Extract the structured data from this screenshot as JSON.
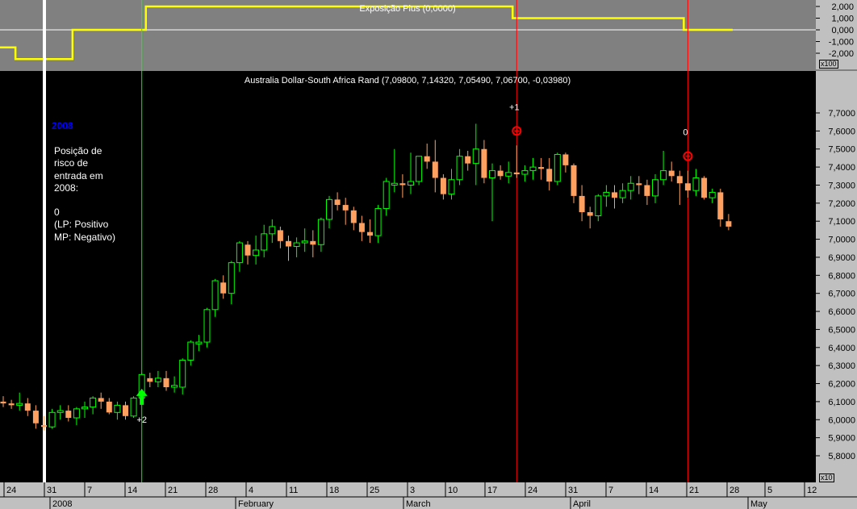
{
  "indicator": {
    "title": "Exposição Plus (0,0000)",
    "y_ticks": [
      "2,000",
      "1,000",
      "0,000",
      "-1,000",
      "-2,000"
    ],
    "multiplier": "x100"
  },
  "price": {
    "title": "Australia Dollar-South Africa Rand (7,09800, 7,14320, 7,05490, 7,06700, -0,03980)",
    "y_ticks": [
      "7,7000",
      "7,6000",
      "7,5000",
      "7,4000",
      "7,3000",
      "7,2000",
      "7,1000",
      "7,0000",
      "6,9000",
      "6,8000",
      "6,7000",
      "6,6000",
      "6,5000",
      "6,4000",
      "6,3000",
      "6,2000",
      "6,1000",
      "6,0000",
      "5,9000",
      "5,8000"
    ],
    "multiplier": "x10"
  },
  "info": {
    "year": "2008",
    "lines": [
      "Posição de",
      "risco de",
      "entrada em",
      "2008:",
      "",
      "0",
      "(LP: Positivo",
      "MP: Negativo)"
    ]
  },
  "signals": [
    {
      "label": "+2",
      "type": "up-arrow",
      "index": 17
    },
    {
      "label": "+1",
      "type": "circle",
      "index": 63
    },
    {
      "label": "0",
      "type": "circle",
      "index": 84
    }
  ],
  "x_axis": {
    "day_ticks": [
      "24",
      "31",
      "7",
      "14",
      "21",
      "28",
      "4",
      "11",
      "18",
      "25",
      "3",
      "10",
      "17",
      "24",
      "31",
      "7",
      "14",
      "21",
      "28",
      "5",
      "12"
    ],
    "months": [
      "2008",
      "February",
      "March",
      "April",
      "May"
    ]
  },
  "colors": {
    "up": "#00ff00",
    "down": "#ffa060",
    "indicator_line": "#ffff00",
    "indicator_bg": "#808080",
    "signal_line": "#ff0000",
    "entry_line": "#00ff00",
    "year_text": "#0000ff"
  },
  "chart_data": {
    "type": "candlestick",
    "title": "Australia Dollar-South Africa Rand (7,09800, 7,14320, 7,05490, 7,06700, -0,03980)",
    "ylim": [
      5.8,
      7.75
    ],
    "indicator_title": "Exposição Plus (0,0000)",
    "indicator_ylim": [
      -3,
      2.6
    ],
    "indicator": [
      -1.5,
      -1.5,
      -2.5,
      -2.5,
      -2.5,
      -2.5,
      -2.5,
      -2.5,
      -2.5,
      0,
      0,
      0,
      0,
      0,
      0,
      0,
      0,
      0,
      2,
      2,
      2,
      2,
      2,
      2,
      2,
      2,
      2,
      2,
      2,
      2,
      2,
      2,
      2,
      2,
      2,
      2,
      2,
      2,
      2,
      2,
      2,
      2,
      2,
      2,
      2,
      2,
      2,
      2,
      2,
      2,
      2,
      2,
      2,
      2,
      2,
      2,
      2,
      2,
      2,
      2,
      2,
      2,
      2,
      1,
      1,
      1,
      1,
      1,
      1,
      1,
      1,
      1,
      1,
      1,
      1,
      1,
      1,
      1,
      1,
      1,
      1,
      1,
      1,
      1,
      0,
      0,
      0,
      0,
      0,
      0
    ],
    "ohlc": [
      [
        6.1,
        6.13,
        6.07,
        6.09
      ],
      [
        6.09,
        6.11,
        6.06,
        6.08
      ],
      [
        6.08,
        6.15,
        6.05,
        6.09
      ],
      [
        6.09,
        6.12,
        6.02,
        6.05
      ],
      [
        6.05,
        6.08,
        5.95,
        5.98
      ],
      [
        5.97,
        6.02,
        5.94,
        5.96
      ],
      [
        5.96,
        6.06,
        5.95,
        6.04
      ],
      [
        6.04,
        6.08,
        6.0,
        6.05
      ],
      [
        6.05,
        6.08,
        5.99,
        6.01
      ],
      [
        6.01,
        6.07,
        5.97,
        6.06
      ],
      [
        6.06,
        6.1,
        6.01,
        6.07
      ],
      [
        6.07,
        6.13,
        6.03,
        6.12
      ],
      [
        6.12,
        6.15,
        6.06,
        6.1
      ],
      [
        6.1,
        6.12,
        6.03,
        6.04
      ],
      [
        6.04,
        6.1,
        6.0,
        6.08
      ],
      [
        6.08,
        6.1,
        6.0,
        6.02
      ],
      [
        6.02,
        6.13,
        6.01,
        6.12
      ],
      [
        6.12,
        6.26,
        6.1,
        6.25
      ],
      [
        6.23,
        6.26,
        6.18,
        6.21
      ],
      [
        6.21,
        6.27,
        6.18,
        6.23
      ],
      [
        6.23,
        6.27,
        6.16,
        6.18
      ],
      [
        6.18,
        6.24,
        6.15,
        6.19
      ],
      [
        6.18,
        6.34,
        6.14,
        6.33
      ],
      [
        6.33,
        6.44,
        6.3,
        6.43
      ],
      [
        6.42,
        6.47,
        6.38,
        6.43
      ],
      [
        6.43,
        6.62,
        6.4,
        6.61
      ],
      [
        6.61,
        6.78,
        6.57,
        6.77
      ],
      [
        6.76,
        6.8,
        6.67,
        6.7
      ],
      [
        6.7,
        6.88,
        6.64,
        6.87
      ],
      [
        6.87,
        6.99,
        6.82,
        6.98
      ],
      [
        6.97,
        6.99,
        6.86,
        6.91
      ],
      [
        6.91,
        7.02,
        6.86,
        6.94
      ],
      [
        6.94,
        7.08,
        6.9,
        7.03
      ],
      [
        7.03,
        7.11,
        6.98,
        7.07
      ],
      [
        7.05,
        7.07,
        6.95,
        6.99
      ],
      [
        6.99,
        7.02,
        6.88,
        6.96
      ],
      [
        6.96,
        7.01,
        6.9,
        6.98
      ],
      [
        6.98,
        7.06,
        6.93,
        6.99
      ],
      [
        6.99,
        7.05,
        6.9,
        6.97
      ],
      [
        6.97,
        7.12,
        6.93,
        7.11
      ],
      [
        7.11,
        7.24,
        7.06,
        7.22
      ],
      [
        7.22,
        7.26,
        7.16,
        7.19
      ],
      [
        7.19,
        7.23,
        7.08,
        7.16
      ],
      [
        7.16,
        7.18,
        7.05,
        7.09
      ],
      [
        7.09,
        7.13,
        6.99,
        7.04
      ],
      [
        7.04,
        7.11,
        6.98,
        7.02
      ],
      [
        7.02,
        7.19,
        6.98,
        7.17
      ],
      [
        7.17,
        7.34,
        7.13,
        7.32
      ],
      [
        7.3,
        7.5,
        7.26,
        7.31
      ],
      [
        7.31,
        7.36,
        7.23,
        7.3
      ],
      [
        7.3,
        7.48,
        7.25,
        7.32
      ],
      [
        7.32,
        7.45,
        7.3,
        7.46
      ],
      [
        7.46,
        7.53,
        7.39,
        7.43
      ],
      [
        7.43,
        7.55,
        7.26,
        7.34
      ],
      [
        7.34,
        7.36,
        7.22,
        7.25
      ],
      [
        7.25,
        7.39,
        7.22,
        7.33
      ],
      [
        7.33,
        7.5,
        7.3,
        7.46
      ],
      [
        7.46,
        7.49,
        7.38,
        7.42
      ],
      [
        7.42,
        7.64,
        7.3,
        7.5
      ],
      [
        7.5,
        7.55,
        7.31,
        7.34
      ],
      [
        7.34,
        7.42,
        7.1,
        7.38
      ],
      [
        7.38,
        7.41,
        7.33,
        7.35
      ],
      [
        7.35,
        7.43,
        7.31,
        7.37
      ],
      [
        7.37,
        7.52,
        7.34,
        7.36
      ],
      [
        7.36,
        7.41,
        7.32,
        7.38
      ],
      [
        7.38,
        7.45,
        7.33,
        7.4
      ],
      [
        7.4,
        7.45,
        7.33,
        7.39
      ],
      [
        7.39,
        7.45,
        7.27,
        7.32
      ],
      [
        7.32,
        7.48,
        7.3,
        7.47
      ],
      [
        7.47,
        7.48,
        7.37,
        7.41
      ],
      [
        7.41,
        7.42,
        7.2,
        7.24
      ],
      [
        7.24,
        7.3,
        7.1,
        7.15
      ],
      [
        7.15,
        7.18,
        7.06,
        7.13
      ],
      [
        7.13,
        7.25,
        7.1,
        7.24
      ],
      [
        7.24,
        7.3,
        7.18,
        7.26
      ],
      [
        7.26,
        7.3,
        7.17,
        7.23
      ],
      [
        7.23,
        7.31,
        7.2,
        7.27
      ],
      [
        7.27,
        7.35,
        7.22,
        7.31
      ],
      [
        7.31,
        7.35,
        7.25,
        7.3
      ],
      [
        7.3,
        7.33,
        7.19,
        7.24
      ],
      [
        7.24,
        7.36,
        7.2,
        7.33
      ],
      [
        7.33,
        7.49,
        7.3,
        7.38
      ],
      [
        7.38,
        7.43,
        7.32,
        7.35
      ],
      [
        7.35,
        7.38,
        7.19,
        7.31
      ],
      [
        7.31,
        7.38,
        7.23,
        7.27
      ],
      [
        7.27,
        7.39,
        7.24,
        7.34
      ],
      [
        7.34,
        7.35,
        7.22,
        7.23
      ],
      [
        7.23,
        7.28,
        7.2,
        7.26
      ],
      [
        7.26,
        7.28,
        7.07,
        7.11
      ],
      [
        7.1,
        7.14,
        7.05,
        7.07
      ]
    ]
  }
}
